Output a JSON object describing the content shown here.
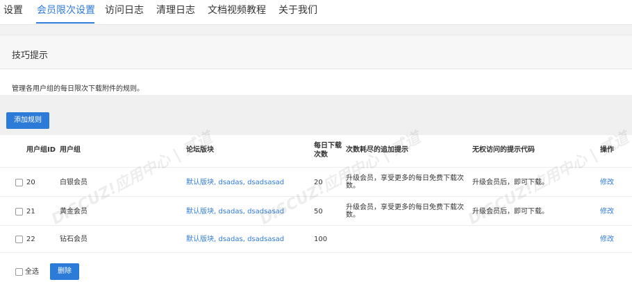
{
  "tabs": [
    {
      "label": "设置"
    },
    {
      "label": "会员限次设置"
    },
    {
      "label": "访问日志"
    },
    {
      "label": "清理日志"
    },
    {
      "label": "文档视频教程"
    },
    {
      "label": "关于我们"
    }
  ],
  "tips": {
    "title": "技巧提示",
    "text": "管理各用户组的每日限次下载附件的规则。"
  },
  "toolbar": {
    "add_label": "添加规则"
  },
  "table": {
    "headers": {
      "group_id": "用户组ID",
      "group": "用户组",
      "forums": "论坛版块",
      "daily_limit_line1": "每日下载",
      "daily_limit_line2": "次数",
      "exhausted_tip": "次数耗尽的追加提示",
      "no_permission_code": "无权访问的提示代码",
      "action": "操作"
    },
    "rows": [
      {
        "id": "20",
        "group": "白银会员",
        "forums": "默认版块, dsadas, dsadsasad",
        "limit": "20",
        "tip": "升级会员，享受更多的每日免费下载次数。",
        "code": "升级会员后，即可下载。",
        "action": "修改"
      },
      {
        "id": "21",
        "group": "黄金会员",
        "forums": "默认版块, dsadas, dsadsasad",
        "limit": "50",
        "tip": "升级会员，享受更多的每日免费下载次数。",
        "code": "升级会员后，即可下载。",
        "action": "修改"
      },
      {
        "id": "22",
        "group": "钻石会员",
        "forums": "默认版块, dsadas, dsadsasad",
        "limit": "100",
        "tip": "",
        "code": "",
        "action": "修改"
      }
    ]
  },
  "footer": {
    "select_all_label": "全选",
    "delete_label": "删除"
  },
  "watermark": {
    "text": "DISCUZ!应用中心 | 贰道"
  },
  "colors": {
    "accent": "#2d7bd9"
  }
}
